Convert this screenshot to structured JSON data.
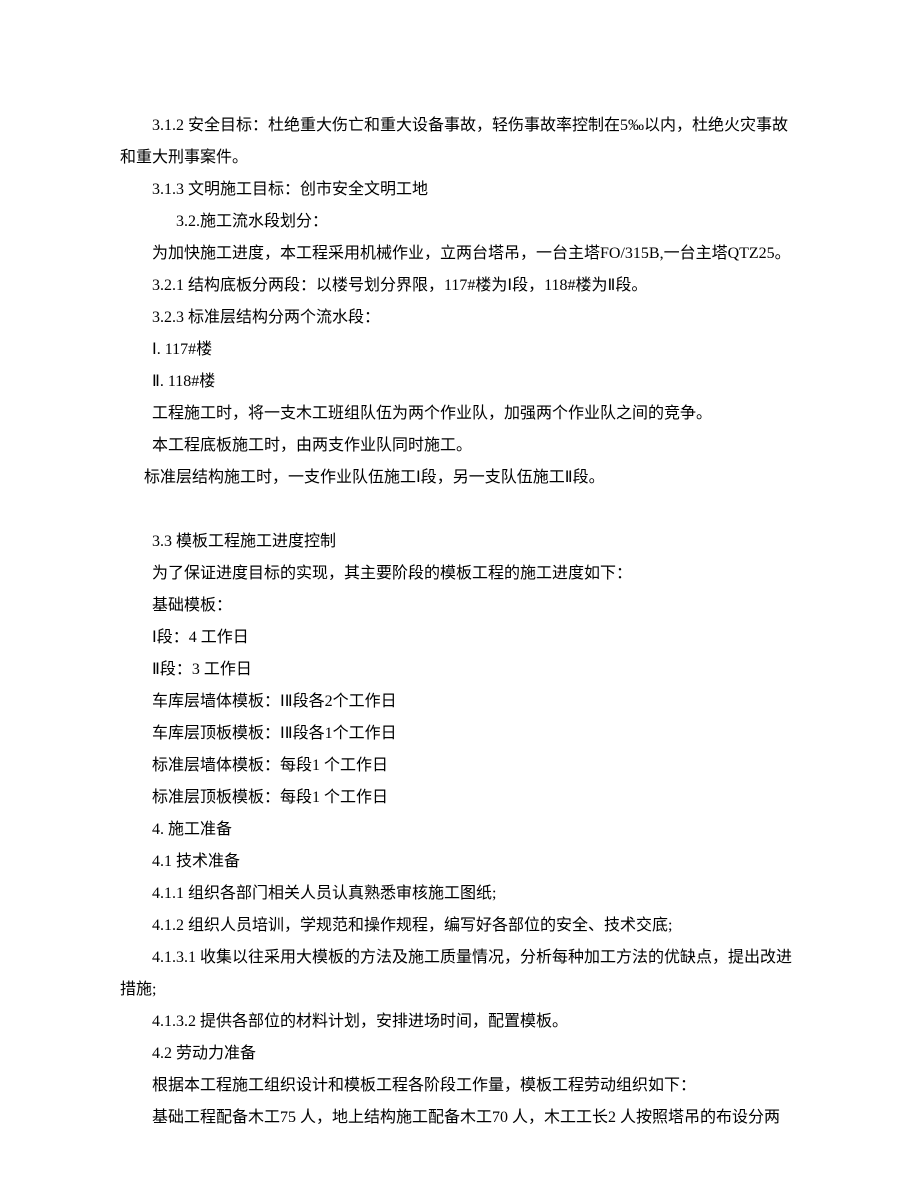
{
  "lines": {
    "l1": "3.1.2 安全目标：杜绝重大伤亡和重大设备事故，轻伤事故率控制在5‰以内，杜绝火灾事故和重大刑事案件。",
    "l2": "3.1.3 文明施工目标：创市安全文明工地",
    "l3": "3.2.施工流水段划分：",
    "l4": "为加快施工进度，本工程采用机械作业，立两台塔吊，一台主塔FO/315B,一台主塔QTZ25。",
    "l5": " 3.2.1 结构底板分两段：以楼号划分界限，117#楼为Ⅰ段，118#楼为Ⅱ段。",
    "l6": "3.2.3 标准层结构分两个流水段：",
    "l7": "Ⅰ. 117#楼",
    "l8": "Ⅱ. 118#楼",
    "l9": "工程施工时，将一支木工班组队伍为两个作业队，加强两个作业队之间的竞争。",
    "l10": "本工程底板施工时，由两支作业队同时施工。",
    "l11": "标准层结构施工时，一支作业队伍施工Ⅰ段，另一支队伍施工Ⅱ段。",
    "l12": " 3.3 模板工程施工进度控制",
    "l13": "为了保证进度目标的实现，其主要阶段的模板工程的施工进度如下：",
    "l14": "基础模板：",
    "l15": "Ⅰ段：4 工作日",
    "l16": "Ⅱ段：3 工作日",
    "l17": "车库层墙体模板：ⅠⅡ段各2个工作日",
    "l18": "车库层顶板模板：ⅠⅡ段各1个工作日",
    "l19": "标准层墙体模板：每段1 个工作日",
    "l20": "标准层顶板模板：每段1 个工作日",
    "l21": "4. 施工准备",
    "l22": "4.1 技术准备",
    "l23": "4.1.1 组织各部门相关人员认真熟悉审核施工图纸;",
    "l24": "4.1.2 组织人员培训，学规范和操作规程，编写好各部位的安全、技术交底;",
    "l25": "4.1.3.1 收集以往采用大模板的方法及施工质量情况，分析每种加工方法的优缺点，提出改进措施;",
    "l26": "4.1.3.2 提供各部位的材料计划，安排进场时间，配置模板。",
    "l27": "4.2 劳动力准备",
    "l28": "根据本工程施工组织设计和模板工程各阶段工作量，模板工程劳动组织如下：",
    "l29": "基础工程配备木工75 人，地上结构施工配备木工70 人，木工工长2 人按照塔吊的布设分两"
  }
}
